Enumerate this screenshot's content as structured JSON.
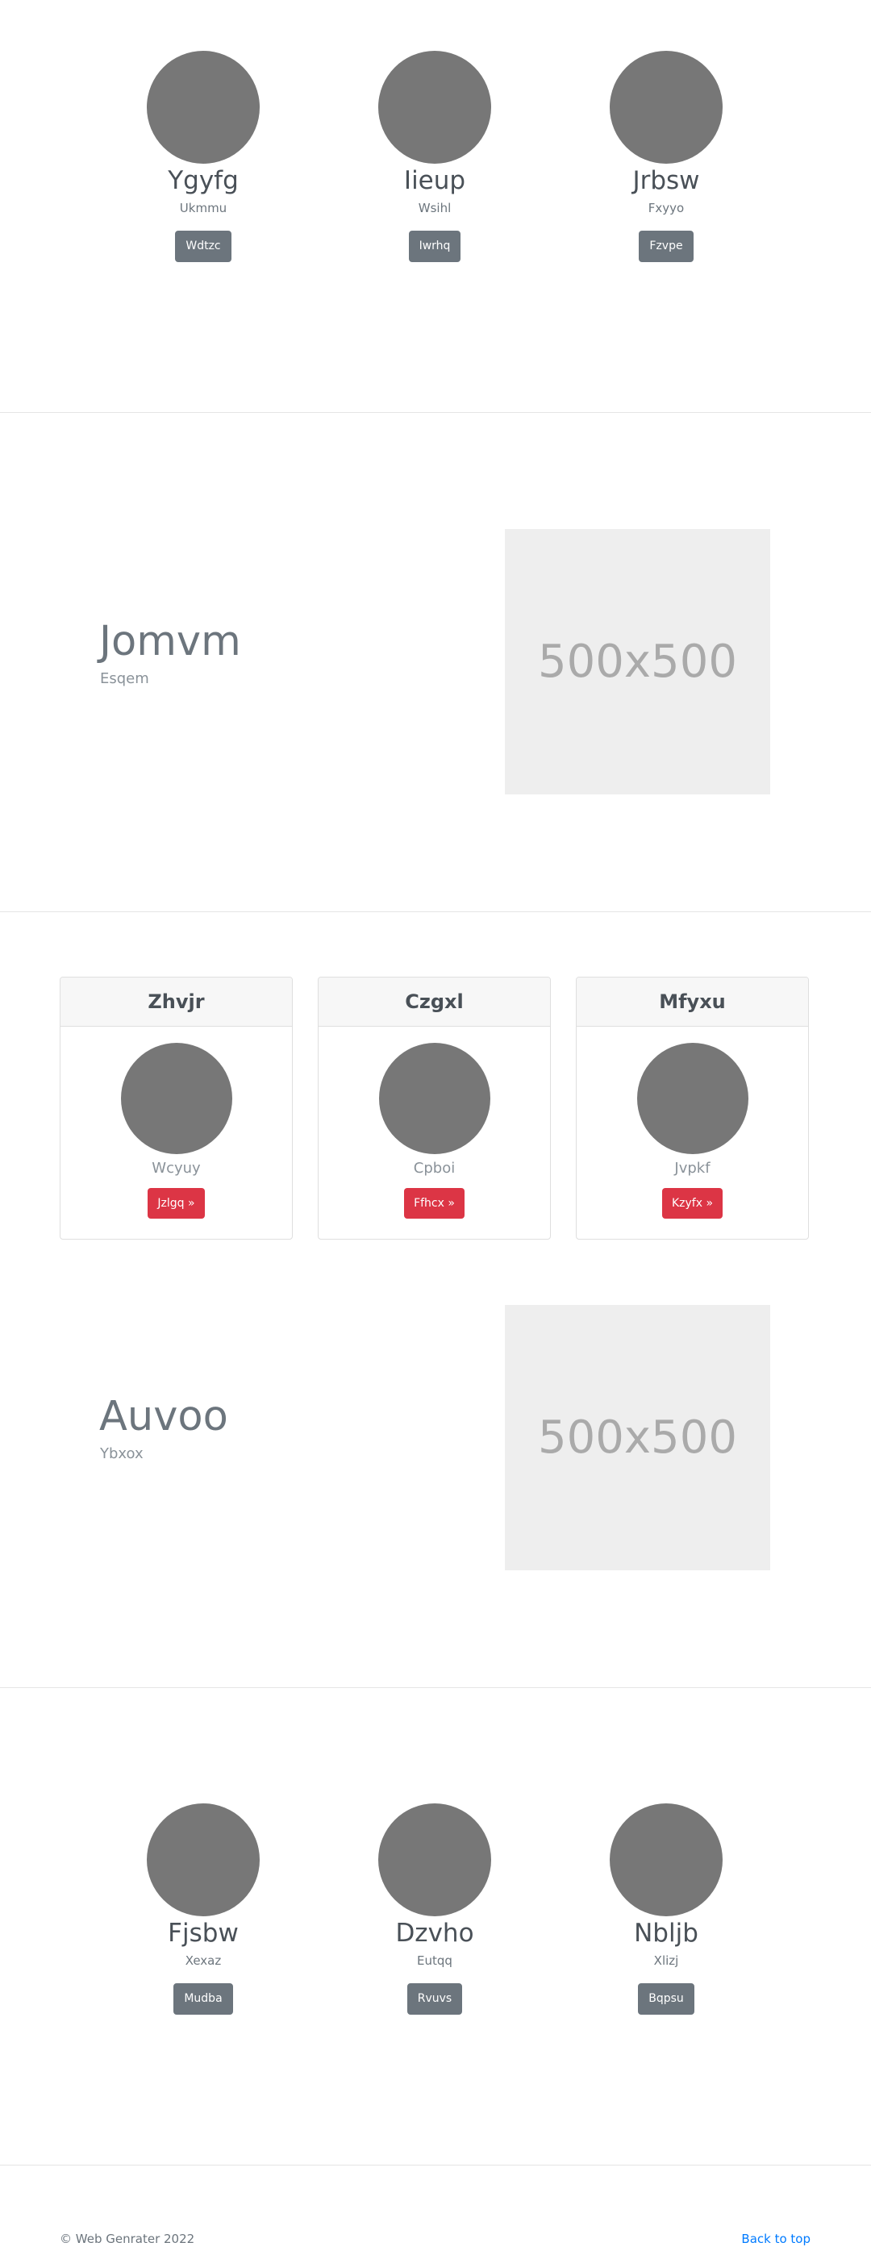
{
  "team_top": [
    {
      "name": "Ygyfg",
      "role": "Ukmmu",
      "button": "Wdtzc"
    },
    {
      "name": "Iieup",
      "role": "Wsihl",
      "button": "Iwrhq"
    },
    {
      "name": "Jrbsw",
      "role": "Fxyyo",
      "button": "Fzvpe"
    }
  ],
  "feature1": {
    "title": "Jomvm",
    "subtitle": "Esqem",
    "image_label": "500x500"
  },
  "cards": [
    {
      "header": "Zhvjr",
      "text": "Wcyuy",
      "button": "Jzlgq »"
    },
    {
      "header": "Czgxl",
      "text": "Cpboi",
      "button": "Ffhcx »"
    },
    {
      "header": "Mfyxu",
      "text": "Jvpkf",
      "button": "Kzyfx »"
    }
  ],
  "feature2": {
    "title": "Auvoo",
    "subtitle": "Ybxox",
    "image_label": "500x500"
  },
  "team_bottom": [
    {
      "name": "Fjsbw",
      "role": "Xexaz",
      "button": "Mudba"
    },
    {
      "name": "Dzvho",
      "role": "Eutqq",
      "button": "Rvuvs"
    },
    {
      "name": "Nbljb",
      "role": "Xlizj",
      "button": "Bqpsu"
    }
  ],
  "footer": {
    "copyright": "© Web Genrater 2022",
    "back_to_top": "Back to top"
  },
  "colors": {
    "secondary": "#6c757d",
    "danger": "#dc3545",
    "link": "#007bff",
    "placeholder_bg": "#eeeeee",
    "avatar": "#777777"
  }
}
